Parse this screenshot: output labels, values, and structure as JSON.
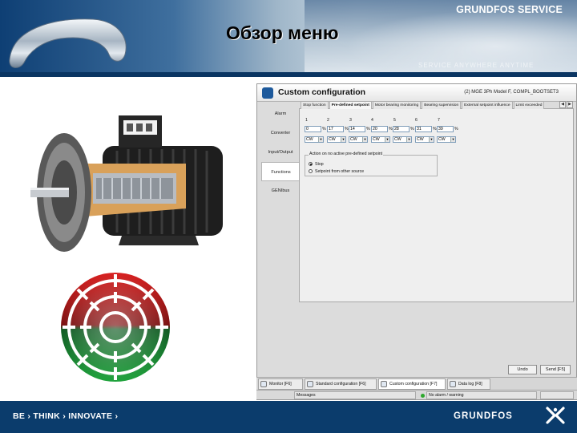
{
  "header": {
    "brand": "GRUNDFOS SERVICE",
    "title": "Обзор меню",
    "watermark": "SERVICE ANYWHERE ANYTIME"
  },
  "window": {
    "title": "Custom configuration",
    "info": "(2) MGE 3Ph Model F, COMPL_BOOTSET3",
    "sidebar": [
      "Alarm",
      "Converter",
      "Input/Output",
      "Functions",
      "GENIbus"
    ],
    "active_sidebar": "Functions",
    "tabs": [
      "Stop function",
      "Pre-defined setpoint",
      "Motor bearing monitoring",
      "Bearing supervision",
      "External setpoint influence",
      "Limit exceeded"
    ],
    "active_tab": "Pre-defined setpoint",
    "setpoints": [
      {
        "index": "1",
        "value": "0",
        "unit": "%",
        "mode": "CW"
      },
      {
        "index": "2",
        "value": "17",
        "unit": "%",
        "mode": "CW"
      },
      {
        "index": "3",
        "value": "14",
        "unit": "%",
        "mode": "CW"
      },
      {
        "index": "4",
        "value": "20",
        "unit": "%",
        "mode": "CW"
      },
      {
        "index": "5",
        "value": "28",
        "unit": "%",
        "mode": "CW"
      },
      {
        "index": "6",
        "value": "31",
        "unit": "%",
        "mode": "CW"
      },
      {
        "index": "7",
        "value": "39",
        "unit": "%",
        "mode": "CW"
      }
    ],
    "group_title": "Action on no active pre-defined setpoint",
    "radio_options": [
      "Stop",
      "Setpoint from other source"
    ],
    "radio_selected": "Stop",
    "undo_label": "Undo",
    "send_label": "Send [F5]",
    "bottom_tabs": [
      "Monitor [F6]",
      "Standard configuration [F6]",
      "Custom configuration [F7]",
      "Data log [F8]"
    ],
    "active_bottom_tab": "Custom configuration [F7]",
    "status": {
      "messages": "Messages",
      "alarm": "No alarm / warning"
    }
  },
  "footer": {
    "slogan": "BE › THINK › INNOVATE ›",
    "logo": "GRUNDFOS"
  },
  "colors": {
    "header_blue": "#0e3f74",
    "footer_blue": "#0b3c6c",
    "gear_red": "#d81f1f",
    "gear_green": "#1fa33c"
  }
}
